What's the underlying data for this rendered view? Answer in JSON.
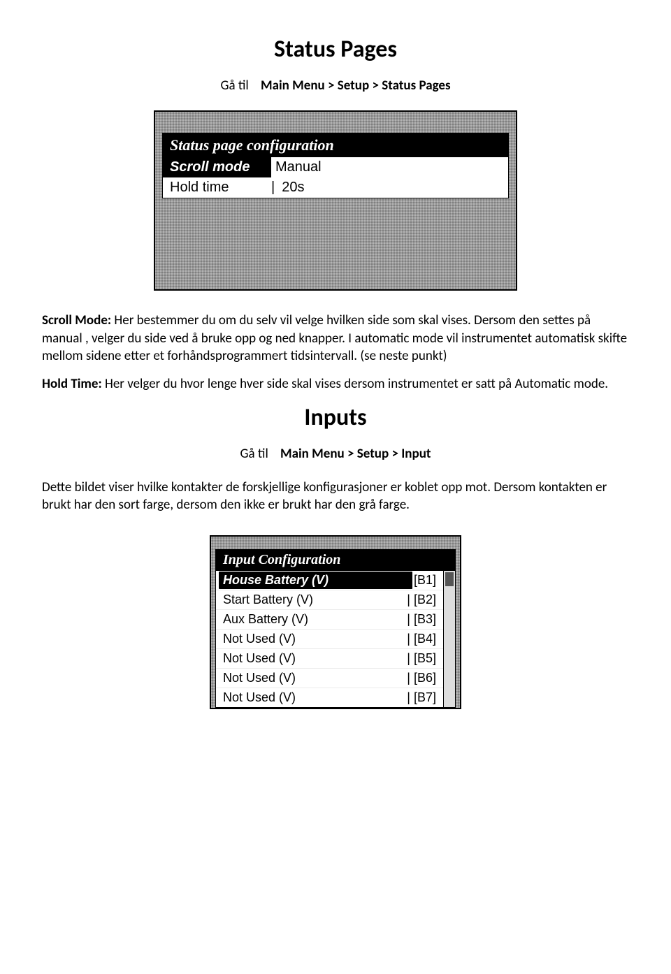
{
  "section1": {
    "heading": "Status Pages",
    "breadcrumb_prefix": "Gå til",
    "breadcrumb_path": "Main Menu > Setup > Status Pages",
    "screenshot": {
      "title": "Status page configuration",
      "rows": [
        {
          "label": "Scroll mode",
          "value": "Manual",
          "selected": true
        },
        {
          "label": "Hold time",
          "value": "20s",
          "selected": false
        }
      ]
    },
    "para_scroll_label": "Scroll Mode:",
    "para_scroll_text": " Her bestemmer du om du selv vil velge hvilken side som skal vises. Dersom den settes på manual , velger du side ved å bruke opp og ned knapper. I automatic mode vil instrumentet automatisk skifte mellom sidene etter et forhåndsprogrammert tidsintervall. (se neste punkt)",
    "para_hold_label": "Hold Time:",
    "para_hold_text": " Her velger du hvor lenge hver side skal vises dersom instrumentet er satt på Automatic mode."
  },
  "section2": {
    "heading": "Inputs",
    "breadcrumb_prefix": "Gå til",
    "breadcrumb_path": "Main Menu > Setup > Input",
    "para": "Dette bildet viser hvilke kontakter de forskjellige konfigurasjoner er koblet opp mot. Dersom kontakten er brukt har den sort farge, dersom den ikke er brukt har den grå farge.",
    "screenshot": {
      "title": "Input Configuration",
      "rows": [
        {
          "label": "House Battery (V)",
          "value": "[B1]",
          "selected": true
        },
        {
          "label": "Start Battery (V)",
          "value": "[B2]",
          "selected": false
        },
        {
          "label": "Aux Battery (V)",
          "value": "[B3]",
          "selected": false
        },
        {
          "label": "Not Used (V)",
          "value": "[B4]",
          "selected": false
        },
        {
          "label": "Not Used (V)",
          "value": "[B5]",
          "selected": false
        },
        {
          "label": "Not Used (V)",
          "value": "[B6]",
          "selected": false
        },
        {
          "label": "Not Used (V)",
          "value": "[B7]",
          "selected": false
        }
      ]
    }
  }
}
